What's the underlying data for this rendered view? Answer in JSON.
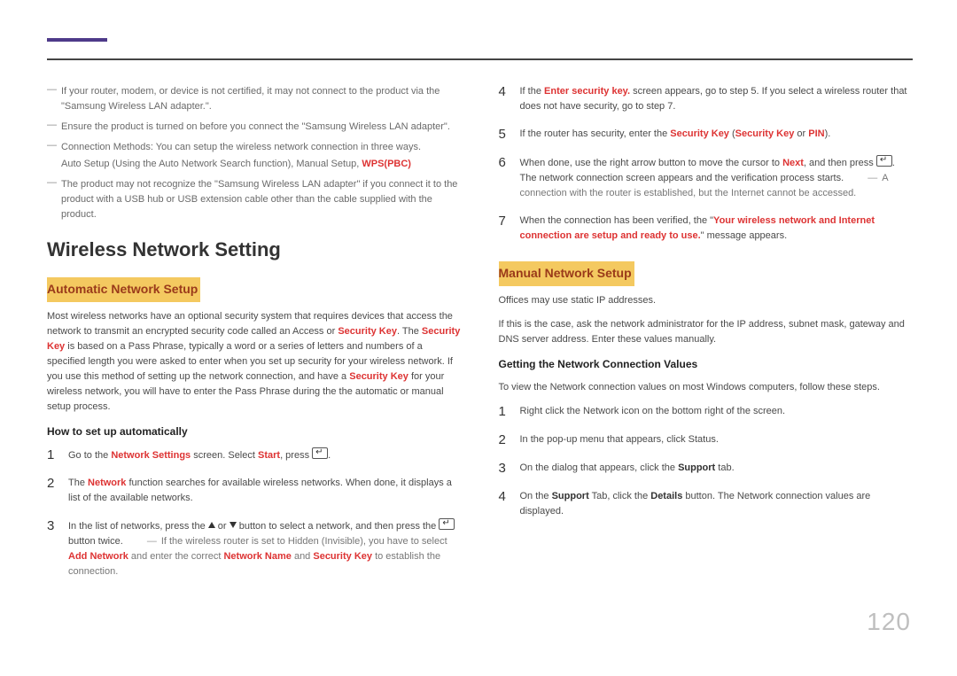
{
  "page_number": "120",
  "left": {
    "notes": [
      {
        "line": "If your router, modem, or device is not certified, it may not connect to the product via the \"Samsung Wireless LAN adapter.\"."
      },
      {
        "line": "Ensure the product is turned on before you connect the \"Samsung Wireless LAN adapter\"."
      },
      {
        "line": "Connection Methods: You can setup the wireless network connection in three ways.",
        "sub_pre": "Auto Setup (Using the Auto Network Search function), Manual Setup, ",
        "sub_hl": "WPS(PBC)"
      },
      {
        "line": "The product may not recognize the \"Samsung Wireless LAN adapter\" if you connect it to the product with a USB hub or USB extension cable other than the cable supplied with the product."
      }
    ],
    "h1": "Wireless Network Setting",
    "hl1": "Automatic Network Setup",
    "para_parts": {
      "a": "Most wireless networks have an optional security system that requires devices that access the network to transmit an encrypted security code called an Access or ",
      "b": "Security Key",
      "c": ". The ",
      "d": "Security Key",
      "e": " is based on a Pass Phrase, typically a word or a series of letters and numbers of a specified length you were asked to enter when you set up security for your wireless network. If you use this method of setting up the network connection, and have a ",
      "f": "Security Key",
      "g": " for your wireless network, you will have to enter the Pass Phrase during the the automatic or manual setup process."
    },
    "subh": "How to set up automatically",
    "steps": {
      "s1": {
        "n": "1",
        "a": "Go to the ",
        "b": "Network Settings",
        "c": " screen. Select ",
        "d": "Start",
        "e": ", press "
      },
      "s2": {
        "n": "2",
        "a": "The ",
        "b": "Network",
        "c": " function searches for available wireless networks. When done, it displays a list of the available networks."
      },
      "s3": {
        "n": "3",
        "a": "In the list of networks, press the ",
        "b": " or ",
        "c": " button to select a network, and then press the ",
        "d": " button twice."
      },
      "s3_note": {
        "a": "If the wireless router is set to Hidden (Invisible), you have to select ",
        "b": "Add Network",
        "c": " and enter the correct ",
        "d": "Network Name",
        "e": " and ",
        "f": "Security Key",
        "g": " to establish the connection."
      }
    }
  },
  "right": {
    "steps": {
      "s4": {
        "n": "4",
        "a": "If the ",
        "b": "Enter security key.",
        "c": " screen appears, go to step 5. If you select a wireless router that does not have security, go to step 7."
      },
      "s5": {
        "n": "5",
        "a": "If the router has security, enter the ",
        "b": "Security Key",
        "c": " (",
        "d": "Security Key",
        "e": " or ",
        "f": "PIN",
        "g": ")."
      },
      "s6": {
        "n": "6",
        "a": "When done, use the right arrow button to move the cursor to ",
        "b": "Next",
        "c": ", and then press ",
        "d": ". The network connection screen appears and the verification process starts."
      },
      "s6_note": "A connection with the router is established, but the Internet cannot be accessed.",
      "s7": {
        "n": "7",
        "a": "When the connection has been verified, the \"",
        "b": "Your wireless network and Internet connection are setup and ready to use.",
        "c": "\" message appears."
      }
    },
    "hl2": "Manual Network Setup",
    "para1": "Offices may use static IP addresses.",
    "para2": "If this is the case, ask the network administrator for the IP address, subnet mask, gateway and DNS server address. Enter these values manually.",
    "subh": "Getting the Network Connection Values",
    "para3": "To view the Network connection values on most Windows computers, follow these steps.",
    "bsteps": {
      "s1": {
        "n": "1",
        "t": "Right click the Network icon on the bottom right of the screen."
      },
      "s2": {
        "n": "2",
        "t": "In the pop-up menu that appears, click Status."
      },
      "s3": {
        "n": "3",
        "a": "On the dialog that appears, click the ",
        "b": "Support",
        "c": " tab."
      },
      "s4": {
        "n": "4",
        "a": "On the ",
        "b": "Support",
        "c": " Tab, click the ",
        "d": "Details",
        "e": " button. The Network connection values are displayed."
      }
    }
  }
}
